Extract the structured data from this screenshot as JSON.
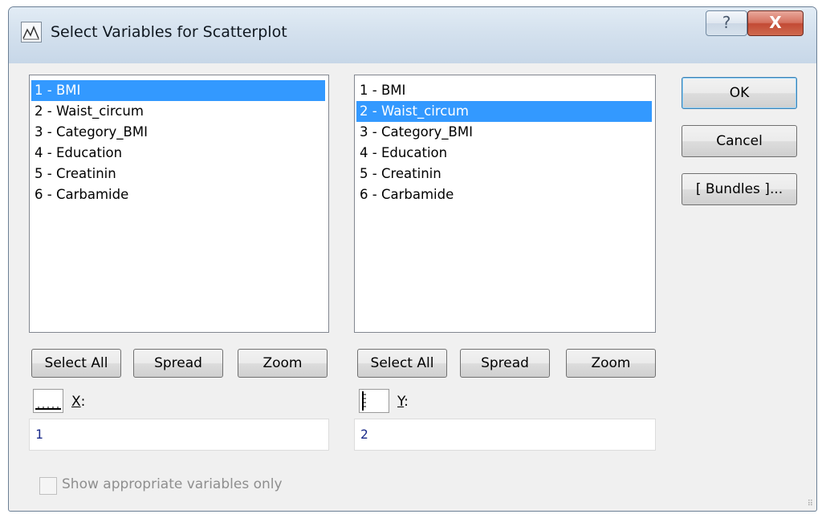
{
  "window": {
    "title": "Select Variables for Scatterplot",
    "help_label": "?",
    "close_label": "X"
  },
  "variables": [
    "1 - BMI",
    "2 - Waist_circum",
    "3 - Category_BMI",
    "4 - Education",
    "5 - Creatinin",
    "6 - Carbamide"
  ],
  "left_list": {
    "selected_index": 0
  },
  "right_list": {
    "selected_index": 1
  },
  "left_buttons": {
    "select_all": "Select All",
    "spread": "Spread",
    "zoom": "Zoom"
  },
  "right_buttons": {
    "select_all": "Select All",
    "spread": "Spread",
    "zoom": "Zoom"
  },
  "x_axis": {
    "label": "X:",
    "value": "1"
  },
  "y_axis": {
    "label": "Y:",
    "value": "2"
  },
  "actions": {
    "ok": "OK",
    "cancel": "Cancel",
    "bundles": "[ Bundles ]..."
  },
  "checkbox": {
    "label": "Show appropriate variables only",
    "checked": false,
    "enabled": false
  },
  "colors": {
    "selection": "#3399ff",
    "close_button": "#c24a34",
    "field_text": "#1a2a8a"
  }
}
